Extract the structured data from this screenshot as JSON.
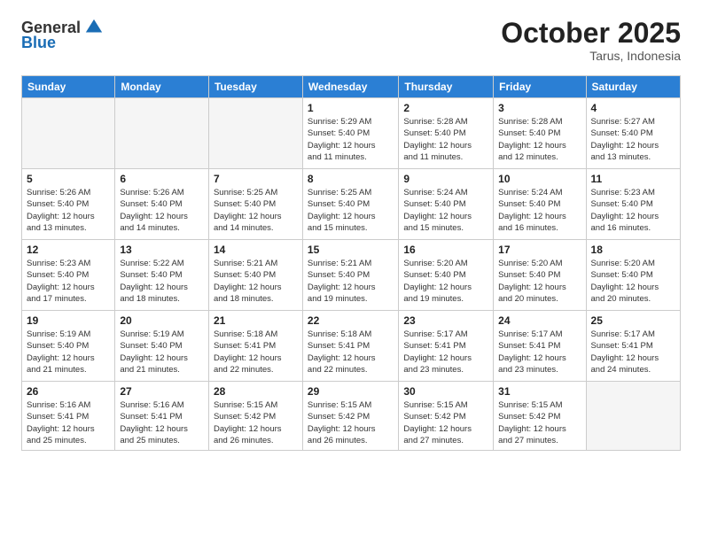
{
  "logo": {
    "general": "General",
    "blue": "Blue"
  },
  "header": {
    "month": "October 2025",
    "location": "Tarus, Indonesia"
  },
  "weekdays": [
    "Sunday",
    "Monday",
    "Tuesday",
    "Wednesday",
    "Thursday",
    "Friday",
    "Saturday"
  ],
  "weeks": [
    [
      {
        "day": "",
        "info": ""
      },
      {
        "day": "",
        "info": ""
      },
      {
        "day": "",
        "info": ""
      },
      {
        "day": "1",
        "info": "Sunrise: 5:29 AM\nSunset: 5:40 PM\nDaylight: 12 hours\nand 11 minutes."
      },
      {
        "day": "2",
        "info": "Sunrise: 5:28 AM\nSunset: 5:40 PM\nDaylight: 12 hours\nand 11 minutes."
      },
      {
        "day": "3",
        "info": "Sunrise: 5:28 AM\nSunset: 5:40 PM\nDaylight: 12 hours\nand 12 minutes."
      },
      {
        "day": "4",
        "info": "Sunrise: 5:27 AM\nSunset: 5:40 PM\nDaylight: 12 hours\nand 13 minutes."
      }
    ],
    [
      {
        "day": "5",
        "info": "Sunrise: 5:26 AM\nSunset: 5:40 PM\nDaylight: 12 hours\nand 13 minutes."
      },
      {
        "day": "6",
        "info": "Sunrise: 5:26 AM\nSunset: 5:40 PM\nDaylight: 12 hours\nand 14 minutes."
      },
      {
        "day": "7",
        "info": "Sunrise: 5:25 AM\nSunset: 5:40 PM\nDaylight: 12 hours\nand 14 minutes."
      },
      {
        "day": "8",
        "info": "Sunrise: 5:25 AM\nSunset: 5:40 PM\nDaylight: 12 hours\nand 15 minutes."
      },
      {
        "day": "9",
        "info": "Sunrise: 5:24 AM\nSunset: 5:40 PM\nDaylight: 12 hours\nand 15 minutes."
      },
      {
        "day": "10",
        "info": "Sunrise: 5:24 AM\nSunset: 5:40 PM\nDaylight: 12 hours\nand 16 minutes."
      },
      {
        "day": "11",
        "info": "Sunrise: 5:23 AM\nSunset: 5:40 PM\nDaylight: 12 hours\nand 16 minutes."
      }
    ],
    [
      {
        "day": "12",
        "info": "Sunrise: 5:23 AM\nSunset: 5:40 PM\nDaylight: 12 hours\nand 17 minutes."
      },
      {
        "day": "13",
        "info": "Sunrise: 5:22 AM\nSunset: 5:40 PM\nDaylight: 12 hours\nand 18 minutes."
      },
      {
        "day": "14",
        "info": "Sunrise: 5:21 AM\nSunset: 5:40 PM\nDaylight: 12 hours\nand 18 minutes."
      },
      {
        "day": "15",
        "info": "Sunrise: 5:21 AM\nSunset: 5:40 PM\nDaylight: 12 hours\nand 19 minutes."
      },
      {
        "day": "16",
        "info": "Sunrise: 5:20 AM\nSunset: 5:40 PM\nDaylight: 12 hours\nand 19 minutes."
      },
      {
        "day": "17",
        "info": "Sunrise: 5:20 AM\nSunset: 5:40 PM\nDaylight: 12 hours\nand 20 minutes."
      },
      {
        "day": "18",
        "info": "Sunrise: 5:20 AM\nSunset: 5:40 PM\nDaylight: 12 hours\nand 20 minutes."
      }
    ],
    [
      {
        "day": "19",
        "info": "Sunrise: 5:19 AM\nSunset: 5:40 PM\nDaylight: 12 hours\nand 21 minutes."
      },
      {
        "day": "20",
        "info": "Sunrise: 5:19 AM\nSunset: 5:40 PM\nDaylight: 12 hours\nand 21 minutes."
      },
      {
        "day": "21",
        "info": "Sunrise: 5:18 AM\nSunset: 5:41 PM\nDaylight: 12 hours\nand 22 minutes."
      },
      {
        "day": "22",
        "info": "Sunrise: 5:18 AM\nSunset: 5:41 PM\nDaylight: 12 hours\nand 22 minutes."
      },
      {
        "day": "23",
        "info": "Sunrise: 5:17 AM\nSunset: 5:41 PM\nDaylight: 12 hours\nand 23 minutes."
      },
      {
        "day": "24",
        "info": "Sunrise: 5:17 AM\nSunset: 5:41 PM\nDaylight: 12 hours\nand 23 minutes."
      },
      {
        "day": "25",
        "info": "Sunrise: 5:17 AM\nSunset: 5:41 PM\nDaylight: 12 hours\nand 24 minutes."
      }
    ],
    [
      {
        "day": "26",
        "info": "Sunrise: 5:16 AM\nSunset: 5:41 PM\nDaylight: 12 hours\nand 25 minutes."
      },
      {
        "day": "27",
        "info": "Sunrise: 5:16 AM\nSunset: 5:41 PM\nDaylight: 12 hours\nand 25 minutes."
      },
      {
        "day": "28",
        "info": "Sunrise: 5:15 AM\nSunset: 5:42 PM\nDaylight: 12 hours\nand 26 minutes."
      },
      {
        "day": "29",
        "info": "Sunrise: 5:15 AM\nSunset: 5:42 PM\nDaylight: 12 hours\nand 26 minutes."
      },
      {
        "day": "30",
        "info": "Sunrise: 5:15 AM\nSunset: 5:42 PM\nDaylight: 12 hours\nand 27 minutes."
      },
      {
        "day": "31",
        "info": "Sunrise: 5:15 AM\nSunset: 5:42 PM\nDaylight: 12 hours\nand 27 minutes."
      },
      {
        "day": "",
        "info": ""
      }
    ]
  ]
}
